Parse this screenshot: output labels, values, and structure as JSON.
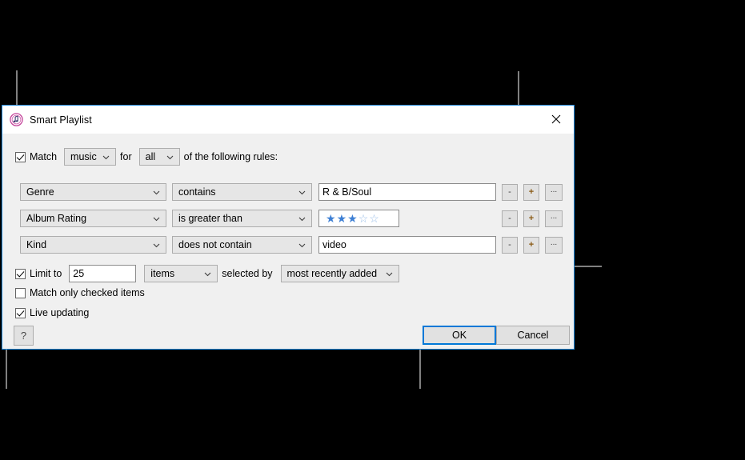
{
  "dialog": {
    "title": "Smart Playlist",
    "app_icon": "itunes-icon",
    "close_icon": "close-icon",
    "accent_color": "#0078d7",
    "border_color": "#1e86d8"
  },
  "match": {
    "checkbox_checked": true,
    "label": "Match",
    "media_type": "music",
    "for_label": "for",
    "scope": "all",
    "suffix_label": "of the following rules:"
  },
  "rules": [
    {
      "field": "Genre",
      "operator": "contains",
      "value": "R & B/Soul",
      "value_type": "text",
      "remove_label": "-",
      "add_label": "+",
      "more_label": "..."
    },
    {
      "field": "Album Rating",
      "operator": "is greater than",
      "value": "3",
      "value_type": "stars",
      "stars_filled": 3,
      "stars_total": 5,
      "star_color": "#3d7fd4",
      "star_empty_color": "#9cbfe8",
      "remove_label": "-",
      "add_label": "+",
      "more_label": "..."
    },
    {
      "field": "Kind",
      "operator": "does not contain",
      "value": "video",
      "value_type": "text",
      "remove_label": "-",
      "add_label": "+",
      "more_label": "..."
    }
  ],
  "limit": {
    "checkbox_checked": true,
    "label": "Limit to",
    "amount": "25",
    "unit": "items",
    "selected_by_label": "selected by",
    "selected_by": "most recently added"
  },
  "match_checked": {
    "checkbox_checked": false,
    "label": "Match only checked items"
  },
  "live_updating": {
    "checkbox_checked": true,
    "label": "Live updating"
  },
  "buttons": {
    "help": "?",
    "ok": "OK",
    "cancel": "Cancel"
  }
}
